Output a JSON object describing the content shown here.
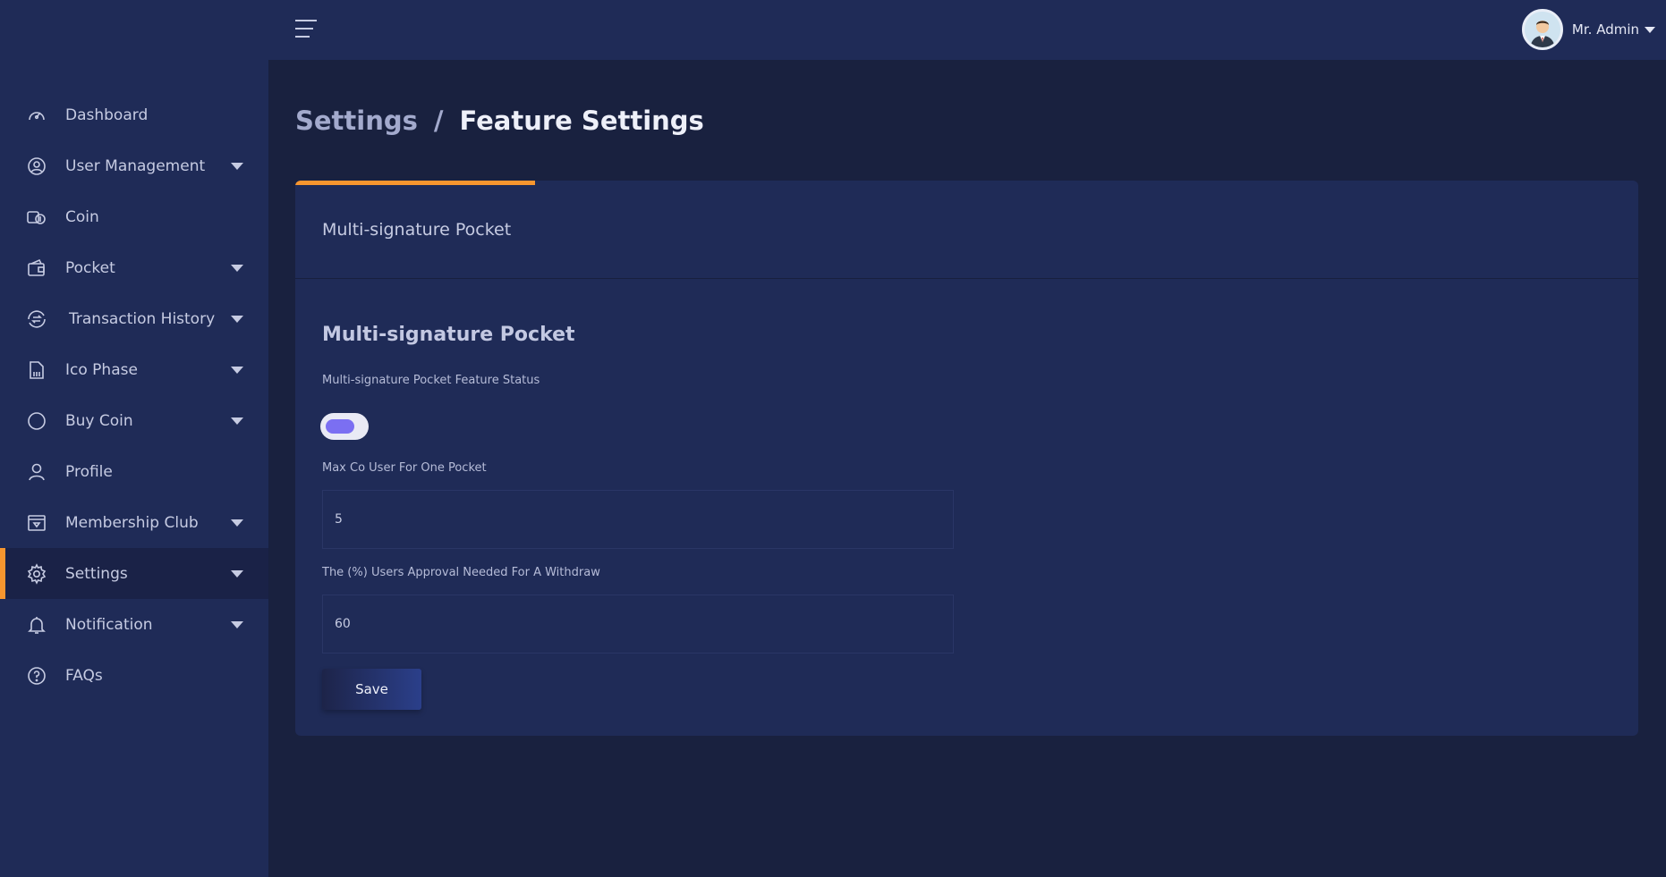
{
  "user": {
    "name": "Mr. Admin",
    "avatar_icon": "avatar-user-icon"
  },
  "sidebar": {
    "items": [
      {
        "label": "Dashboard",
        "icon": "speedometer-icon",
        "has_submenu": false
      },
      {
        "label": "User Management",
        "icon": "user-circle-icon",
        "has_submenu": true
      },
      {
        "label": "Coin",
        "icon": "coin-icon",
        "has_submenu": false
      },
      {
        "label": "Pocket",
        "icon": "wallet-icon",
        "has_submenu": true
      },
      {
        "label": "Transaction History",
        "icon": "transaction-icon",
        "has_submenu": true
      },
      {
        "label": "Ico Phase",
        "icon": "ico-file-icon",
        "has_submenu": true
      },
      {
        "label": "Buy Coin",
        "icon": "circle-icon",
        "has_submenu": true
      },
      {
        "label": "Profile",
        "icon": "person-icon",
        "has_submenu": false
      },
      {
        "label": "Membership Club",
        "icon": "membership-icon",
        "has_submenu": true
      },
      {
        "label": "Settings",
        "icon": "gear-icon",
        "has_submenu": true,
        "active": true
      },
      {
        "label": "Notification",
        "icon": "bell-icon",
        "has_submenu": true
      },
      {
        "label": "FAQs",
        "icon": "question-icon",
        "has_submenu": false
      }
    ]
  },
  "breadcrumb": {
    "parent": "Settings",
    "separator": "/",
    "current": "Feature Settings"
  },
  "card": {
    "header_title": "Multi-signature Pocket",
    "section_title": "Multi-signature Pocket",
    "feature_status_label": "Multi-signature Pocket Feature Status",
    "feature_status_on": true,
    "max_co_user_label": "Max Co User For One Pocket",
    "max_co_user_value": "5",
    "approval_label": "The (%) Users Approval Needed For A Withdraw",
    "approval_value": "60",
    "save_label": "Save"
  },
  "colors": {
    "accent": "#f7962f",
    "toggle": "#7b6ff2",
    "panel": "#1f2b57",
    "background": "#19213f"
  }
}
